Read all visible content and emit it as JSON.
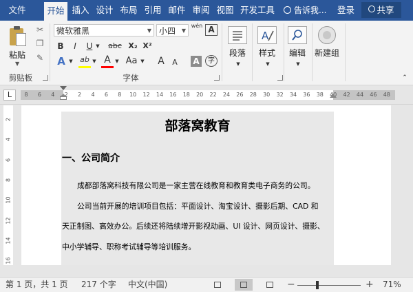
{
  "menubar": {
    "tabs": [
      "文件",
      "开始",
      "插入",
      "设计",
      "布局",
      "引用",
      "邮件",
      "审阅",
      "视图",
      "开发工具"
    ],
    "active_tab": "开始",
    "tell_me": "告诉我...",
    "login": "登录",
    "share": "共享"
  },
  "ribbon": {
    "clipboard": {
      "paste": "粘贴",
      "label": "剪贴板"
    },
    "font": {
      "font_name": "微软雅黑",
      "font_size": "小四",
      "wen": "wén",
      "A": "A",
      "bold": "B",
      "italic": "I",
      "underline": "U",
      "strike": "abc",
      "sub": "X₂",
      "sup": "X²",
      "highlight": "ab",
      "font_color": "A",
      "case": "Aa",
      "grow": "A",
      "shrink": "A",
      "shade": "A",
      "enclose": "字",
      "label": "字体",
      "highlight_color": "#ffff00",
      "font_color_value": "#ff0000"
    },
    "paragraph": {
      "label": "段落"
    },
    "styles": {
      "label": "样式"
    },
    "editing": {
      "label": "编辑"
    },
    "newgroup": {
      "label": "新建组"
    }
  },
  "ruler": {
    "tab_selector": "L",
    "marks": [
      "8",
      "6",
      "4",
      "2",
      "2",
      "4",
      "6",
      "8",
      "10",
      "12",
      "14",
      "16",
      "18",
      "20",
      "22",
      "24",
      "26",
      "28",
      "30",
      "32",
      "34",
      "36",
      "38",
      "40",
      "42",
      "44",
      "46",
      "48"
    ]
  },
  "vruler": {
    "marks": [
      "2",
      "4",
      "6",
      "8",
      "10",
      "12",
      "14",
      "16"
    ]
  },
  "document": {
    "title": "部落窝教育",
    "heading": "一、公司简介",
    "p1": "成都部落窝科技有限公司是一家主营在线教育和教育类电子商务的公司。",
    "p2a": "公司当前开展的培训项目包括：平面设计、淘宝设计、摄影后期、CAD 和",
    "p2b": "天正制图、高效办公。后续还将陆续增开影视动画、UI 设计、网页设计、摄影、",
    "p2c": "中小学辅导、职称考试辅导等培训服务。"
  },
  "status": {
    "page": "第 1 页，共 1 页",
    "words": "217 个字",
    "lang": "中文(中国)",
    "zoom_minus": "−",
    "zoom_plus": "+",
    "zoom": "71%"
  }
}
